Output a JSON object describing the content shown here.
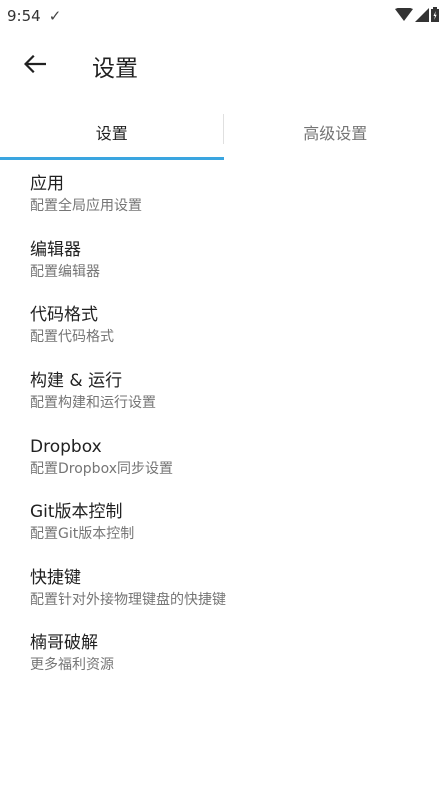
{
  "status_bar": {
    "time": "9:54",
    "icons": [
      "check-icon",
      "wifi-icon",
      "signal-icon",
      "battery-icon"
    ]
  },
  "app_bar": {
    "title": "设置",
    "back_icon": "arrow-left-icon"
  },
  "tabs": [
    {
      "label": "设置",
      "active": true
    },
    {
      "label": "高级设置",
      "active": false
    }
  ],
  "accent_color": "#3aa5e0",
  "items": [
    {
      "title": "应用",
      "subtitle": "配置全局应用设置"
    },
    {
      "title": "编辑器",
      "subtitle": "配置编辑器"
    },
    {
      "title": "代码格式",
      "subtitle": "配置代码格式"
    },
    {
      "title": "构建 & 运行",
      "subtitle": "配置构建和运行设置"
    },
    {
      "title": "Dropbox",
      "subtitle": "配置Dropbox同步设置"
    },
    {
      "title": "Git版本控制",
      "subtitle": "配置Git版本控制"
    },
    {
      "title": "快捷键",
      "subtitle": "配置针对外接物理键盘的快捷键"
    },
    {
      "title": "楠哥破解",
      "subtitle": "更多福利资源"
    }
  ]
}
